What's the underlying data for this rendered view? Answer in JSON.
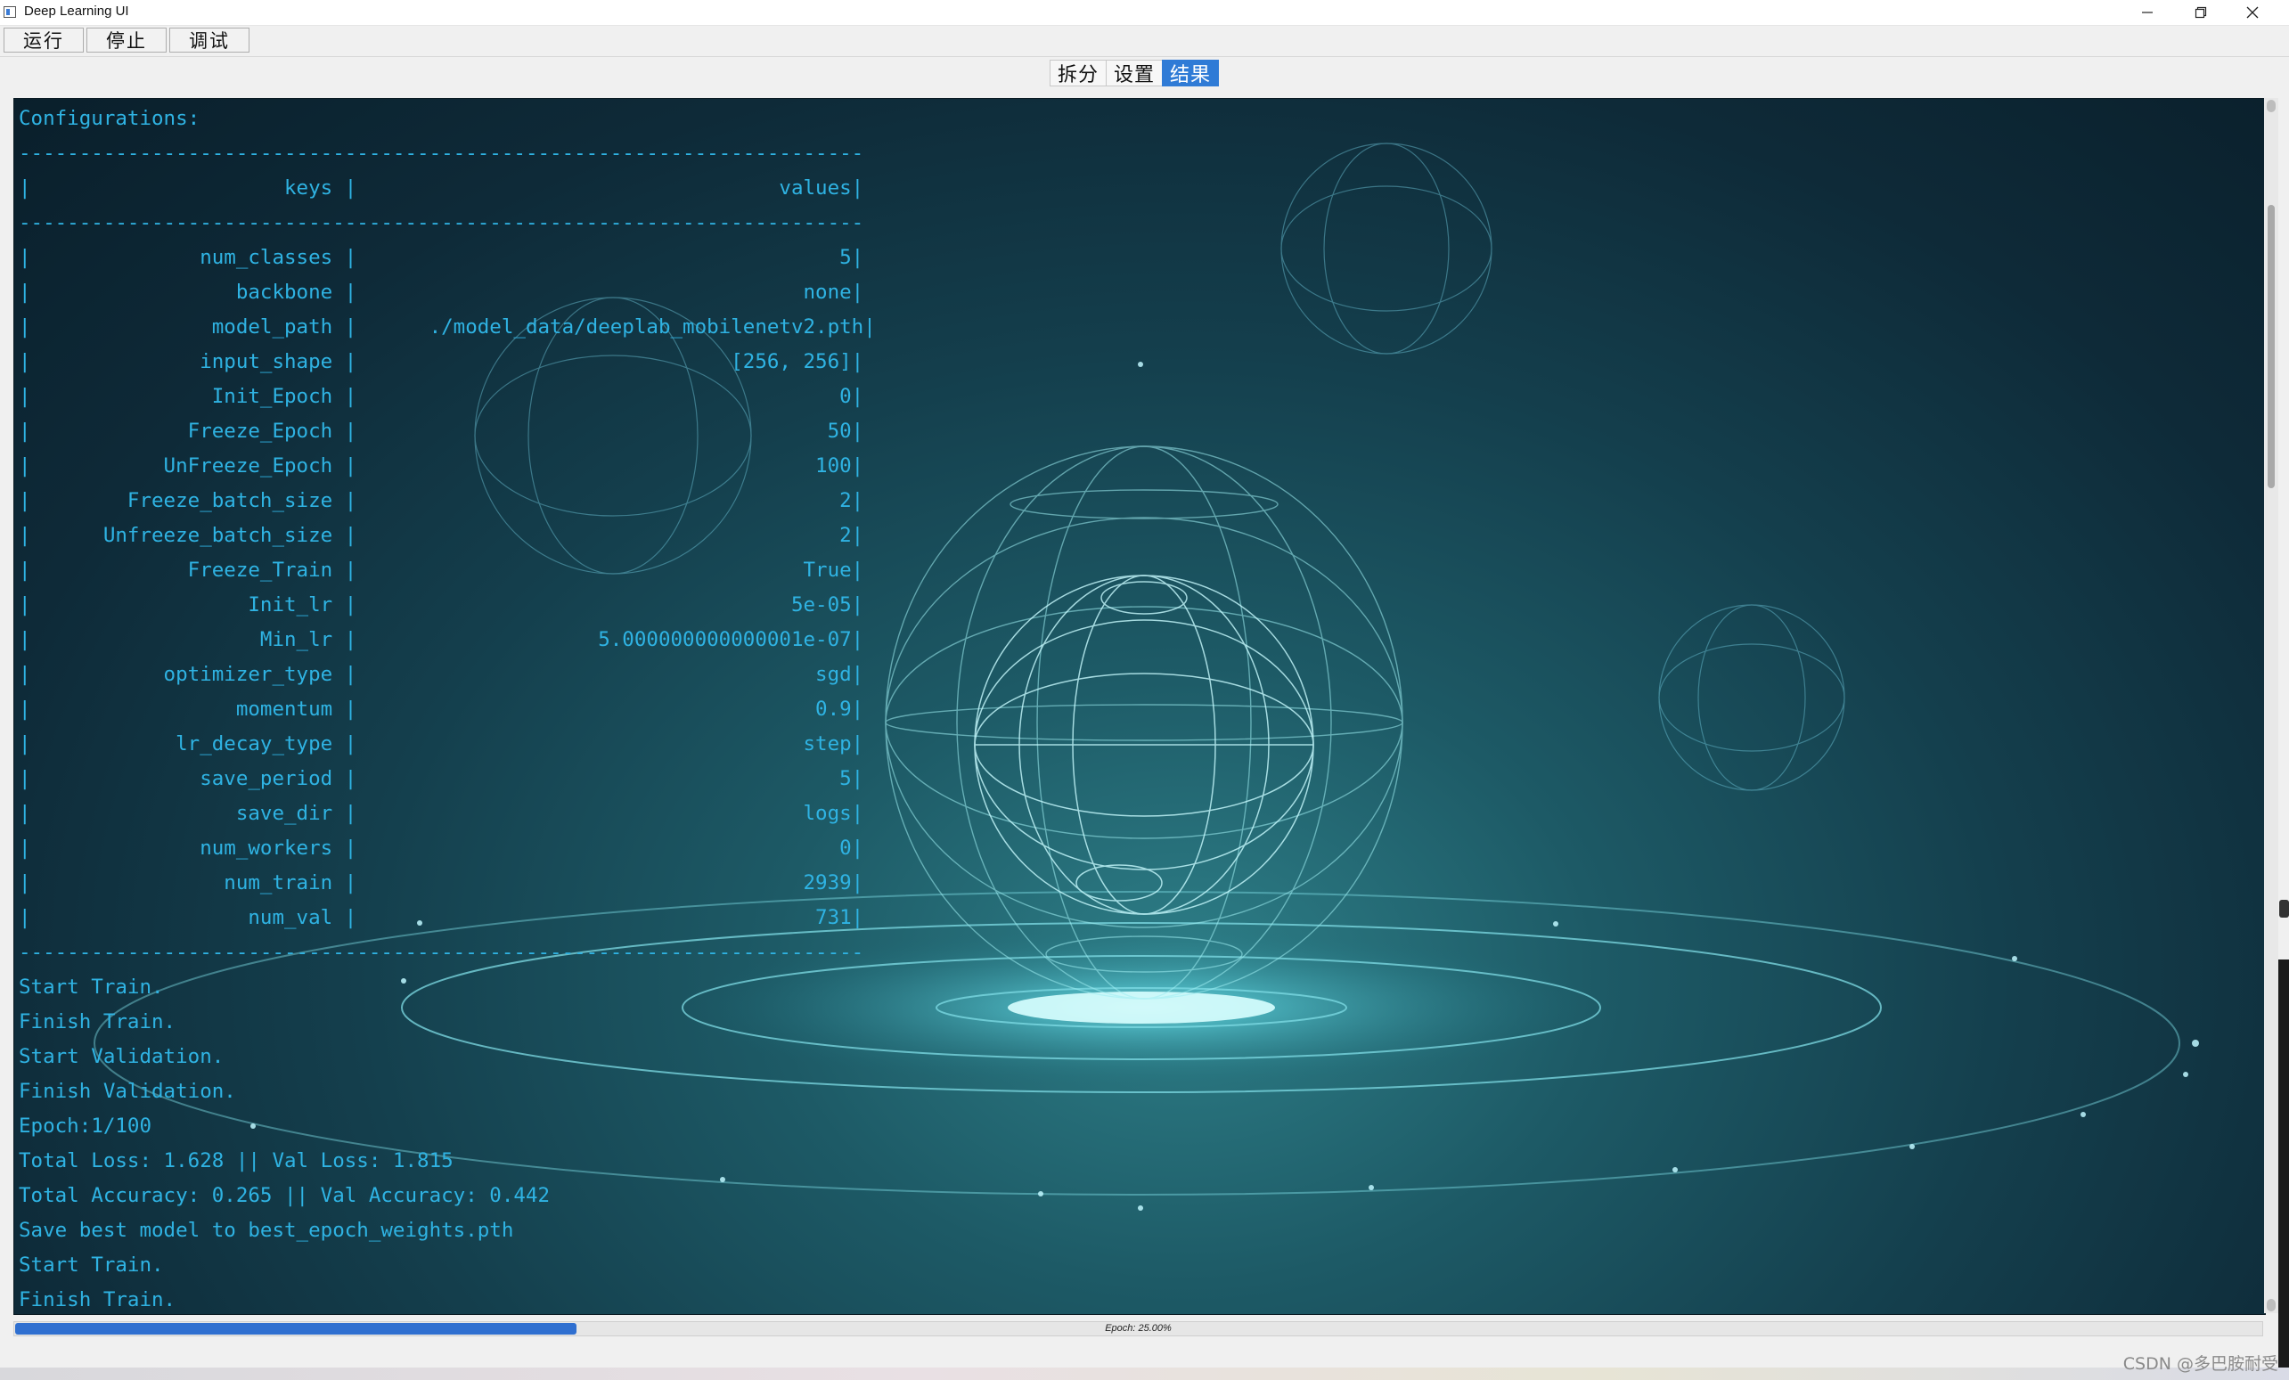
{
  "window": {
    "title": "Deep Learning UI",
    "icons": [
      "app-icon",
      "minimize-icon",
      "restore-icon",
      "close-icon"
    ]
  },
  "toolbar": {
    "run_label": "运行",
    "stop_label": "停止",
    "debug_label": "调试"
  },
  "tabs": [
    {
      "label": "拆分",
      "active": false
    },
    {
      "label": "设置",
      "active": false
    },
    {
      "label": "结果",
      "active": true
    }
  ],
  "console": {
    "text_color": "#2fb3e3",
    "lines": [
      "Configurations:",
      "----------------------------------------------------------------------",
      "|                     keys |                                   values|",
      "----------------------------------------------------------------------",
      "|              num_classes |                                        5|",
      "|                 backbone |                                     none|",
      "|               model_path |      ./model_data/deeplab_mobilenetv2.pth|",
      "|              input_shape |                               [256, 256]|",
      "|               Init_Epoch |                                        0|",
      "|             Freeze_Epoch |                                       50|",
      "|           UnFreeze_Epoch |                                      100|",
      "|        Freeze_batch_size |                                        2|",
      "|      Unfreeze_batch_size |                                        2|",
      "|             Freeze_Train |                                     True|",
      "|                  Init_lr |                                    5e-05|",
      "|                   Min_lr |                    5.000000000000001e-07|",
      "|           optimizer_type |                                      sgd|",
      "|                 momentum |                                      0.9|",
      "|            lr_decay_type |                                     step|",
      "|              save_period |                                        5|",
      "|                 save_dir |                                     logs|",
      "|              num_workers |                                        0|",
      "|                num_train |                                     2939|",
      "|                  num_val |                                      731|",
      "----------------------------------------------------------------------",
      "Start Train.",
      "Finish Train.",
      "Start Validation.",
      "Finish Validation.",
      "Epoch:1/100",
      "Total Loss: 1.628 || Val Loss: 1.815",
      "Total Accuracy: 0.265 || Val Accuracy: 0.442",
      "Save best model to best_epoch_weights.pth",
      "Start Train.",
      "Finish Train."
    ]
  },
  "progress": {
    "value": 0.25,
    "label": "Epoch: 25.00%",
    "color": "#2f6fd0"
  },
  "watermark": "CSDN @多巴胺耐受"
}
